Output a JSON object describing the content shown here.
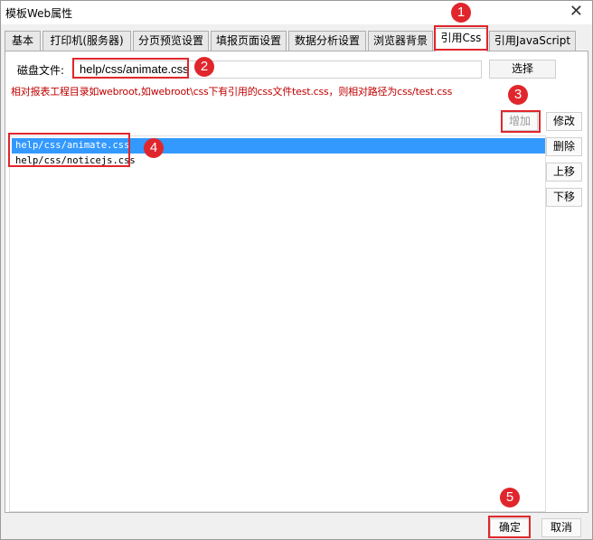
{
  "window": {
    "title": "模板Web属性",
    "close_icon": "close-icon"
  },
  "tabs": [
    {
      "label": "基本",
      "active": false
    },
    {
      "label": "打印机(服务器)",
      "active": false
    },
    {
      "label": "分页预览设置",
      "active": false
    },
    {
      "label": "填报页面设置",
      "active": false
    },
    {
      "label": "数据分析设置",
      "active": false
    },
    {
      "label": "浏览器背景",
      "active": false
    },
    {
      "label": "引用Css",
      "active": true
    },
    {
      "label": "引用JavaScript",
      "active": false
    }
  ],
  "file": {
    "label": "磁盘文件:",
    "value": "help/css/animate.css",
    "browse_label": "选择"
  },
  "hint": "相对报表工程目录如webroot,如webroot\\css下有引用的css文件test.css，则相对路径为css/test.css",
  "side_buttons": {
    "add": "增加",
    "edit": "修改",
    "delete": "删除",
    "up": "上移",
    "down": "下移"
  },
  "list": {
    "items": [
      {
        "text": "help/css/animate.css",
        "selected": true
      },
      {
        "text": "help/css/noticejs.css",
        "selected": false
      }
    ]
  },
  "footer": {
    "ok": "确定",
    "cancel": "取消"
  },
  "annotations": [
    "1",
    "2",
    "3",
    "4",
    "5"
  ],
  "colors": {
    "annotation_red": "#e0262c",
    "hint_red": "#c00000",
    "selection_blue": "#3399ff"
  }
}
